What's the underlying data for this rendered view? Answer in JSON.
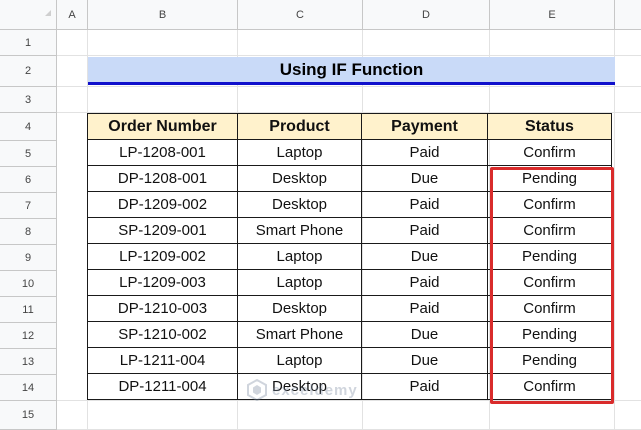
{
  "columns": [
    "A",
    "B",
    "C",
    "D",
    "E"
  ],
  "rows": [
    "1",
    "2",
    "3",
    "4",
    "5",
    "6",
    "7",
    "8",
    "9",
    "10",
    "11",
    "12",
    "13",
    "14",
    "15"
  ],
  "title": "Using IF Function",
  "table": {
    "headers": [
      "Order Number",
      "Product",
      "Payment",
      "Status"
    ],
    "rows": [
      [
        "LP-1208-001",
        "Laptop",
        "Paid",
        "Confirm"
      ],
      [
        "DP-1208-001",
        "Desktop",
        "Due",
        "Pending"
      ],
      [
        "DP-1209-002",
        "Desktop",
        "Paid",
        "Confirm"
      ],
      [
        "SP-1209-001",
        "Smart Phone",
        "Paid",
        "Confirm"
      ],
      [
        "LP-1209-002",
        "Laptop",
        "Due",
        "Pending"
      ],
      [
        "LP-1209-003",
        "Laptop",
        "Paid",
        "Confirm"
      ],
      [
        "DP-1210-003",
        "Desktop",
        "Paid",
        "Confirm"
      ],
      [
        "SP-1210-002",
        "Smart Phone",
        "Due",
        "Pending"
      ],
      [
        "LP-1211-004",
        "Laptop",
        "Due",
        "Pending"
      ],
      [
        "DP-1211-004",
        "Desktop",
        "Paid",
        "Confirm"
      ]
    ]
  },
  "watermark": "exceldemy",
  "colors": {
    "title_bg": "#c9daf8",
    "title_underline": "#1010cc",
    "header_bg": "#fff2cc",
    "highlight_border": "#d92b2b"
  }
}
